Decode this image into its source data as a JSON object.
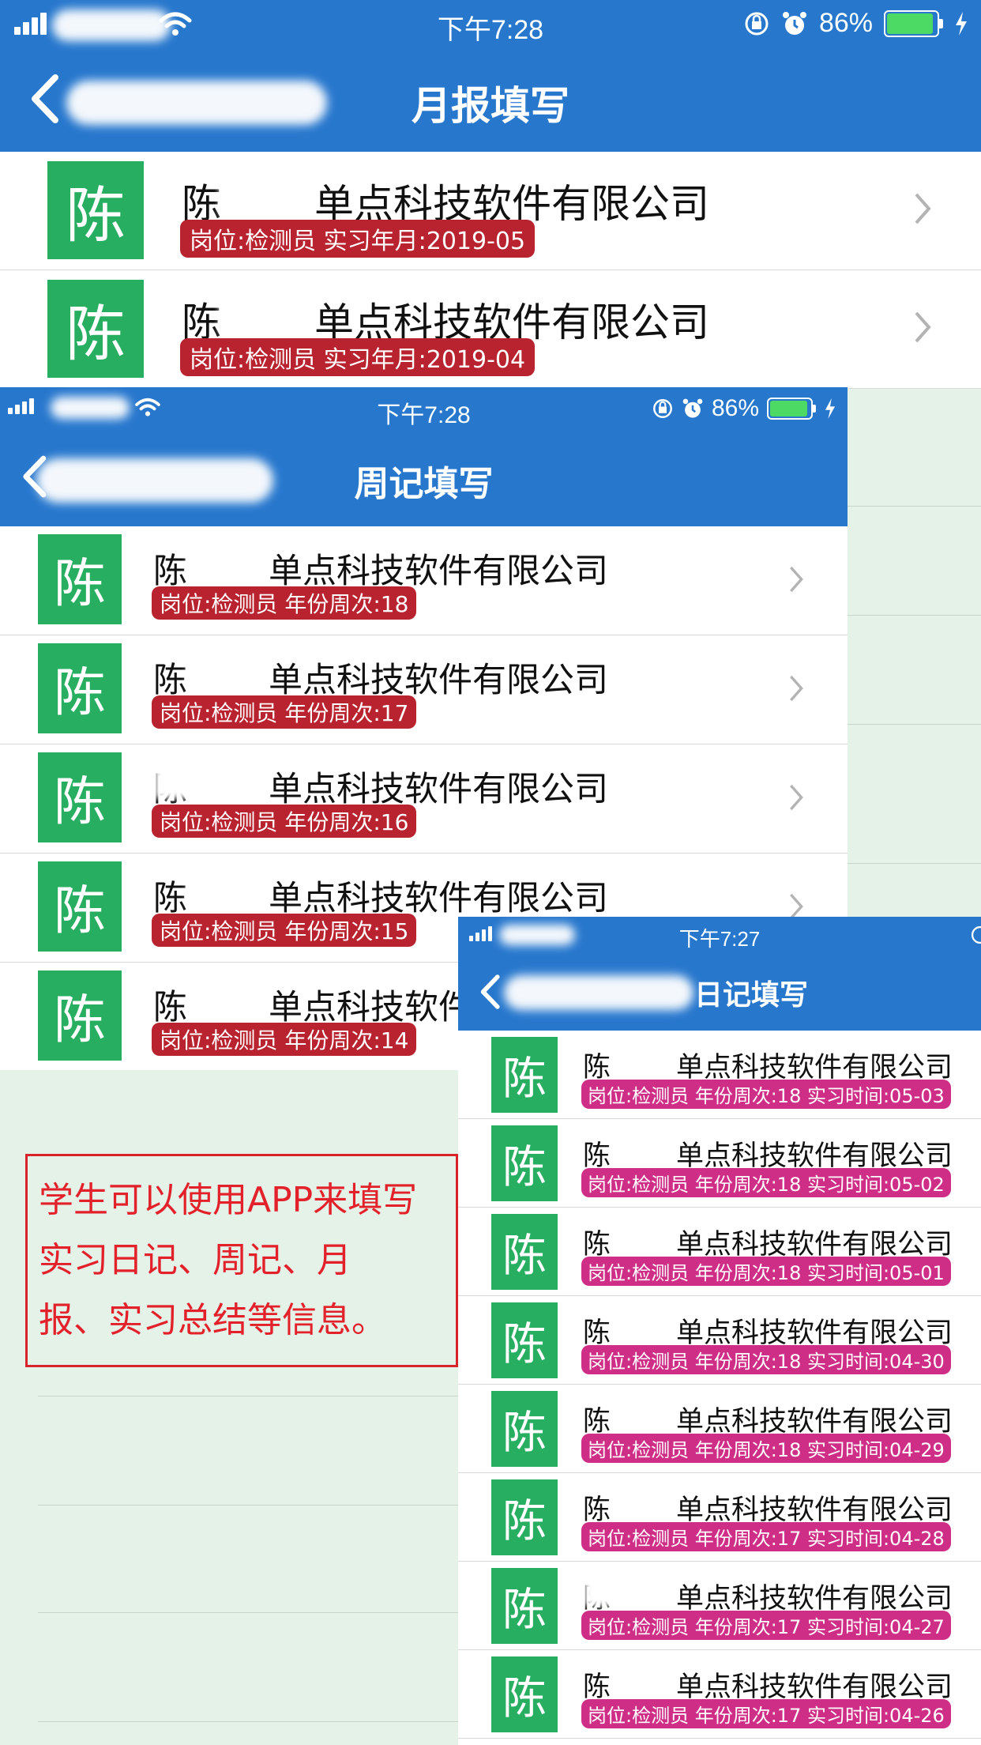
{
  "monthly": {
    "status_time": "下午7:28",
    "battery": "86%",
    "title": "月报填写",
    "rows": [
      {
        "avatar": "陈",
        "name": "陈",
        "company": "单点科技软件有限公司",
        "badge": "岗位:检测员 实习年月:2019-05"
      },
      {
        "avatar": "陈",
        "name": "陈",
        "company": "单点科技软件有限公司",
        "badge": "岗位:检测员 实习年月:2019-04"
      }
    ]
  },
  "weekly": {
    "status_time": "下午7:28",
    "battery": "86%",
    "title": "周记填写",
    "rows": [
      {
        "avatar": "陈",
        "name": "陈",
        "company": "单点科技软件有限公司",
        "badge": "岗位:检测员 年份周次:18"
      },
      {
        "avatar": "陈",
        "name": "陈",
        "company": "单点科技软件有限公司",
        "badge": "岗位:检测员 年份周次:17"
      },
      {
        "avatar": "陈",
        "name": "陈",
        "company": "单点科技软件有限公司",
        "badge": "岗位:检测员 年份周次:16"
      },
      {
        "avatar": "陈",
        "name": "陈",
        "company": "单点科技软件有限公司",
        "badge": "岗位:检测员 年份周次:15"
      },
      {
        "avatar": "陈",
        "name": "陈",
        "company": "单点科技软件",
        "badge": "岗位:检测员 年份周次:14"
      }
    ]
  },
  "daily": {
    "status_time": "下午7:27",
    "title": "日记填写",
    "rows": [
      {
        "avatar": "陈",
        "name": "陈",
        "company": "单点科技软件有限公司",
        "badge": "岗位:检测员 年份周次:18 实习时间:05-03"
      },
      {
        "avatar": "陈",
        "name": "陈",
        "company": "单点科技软件有限公司",
        "badge": "岗位:检测员 年份周次:18 实习时间:05-02"
      },
      {
        "avatar": "陈",
        "name": "陈",
        "company": "单点科技软件有限公司",
        "badge": "岗位:检测员 年份周次:18 实习时间:05-01"
      },
      {
        "avatar": "陈",
        "name": "陈",
        "company": "单点科技软件有限公司",
        "badge": "岗位:检测员 年份周次:18 实习时间:04-30"
      },
      {
        "avatar": "陈",
        "name": "陈",
        "company": "单点科技软件有限公司",
        "badge": "岗位:检测员 年份周次:18 实习时间:04-29"
      },
      {
        "avatar": "陈",
        "name": "陈",
        "company": "单点科技软件有限公司",
        "badge": "岗位:检测员 年份周次:17 实习时间:04-28"
      },
      {
        "avatar": "陈",
        "name": "陈",
        "company": "单点科技软件有限公司",
        "badge": "岗位:检测员 年份周次:17 实习时间:04-27"
      },
      {
        "avatar": "陈",
        "name": "陈",
        "company": "单点科技软件有限公司",
        "badge": "岗位:检测员 年份周次:17 实习时间:04-26"
      }
    ]
  },
  "annotation": {
    "lines": [
      "学生可以使用APP来填写",
      "实习日记、周记、月",
      "报、实习总结等信息。"
    ]
  },
  "colors": {
    "header": "#2777cd",
    "avatar": "#27ae60",
    "badge_red": "#b8232f",
    "badge_pink": "#cf2e86",
    "note": "#e2212a"
  }
}
